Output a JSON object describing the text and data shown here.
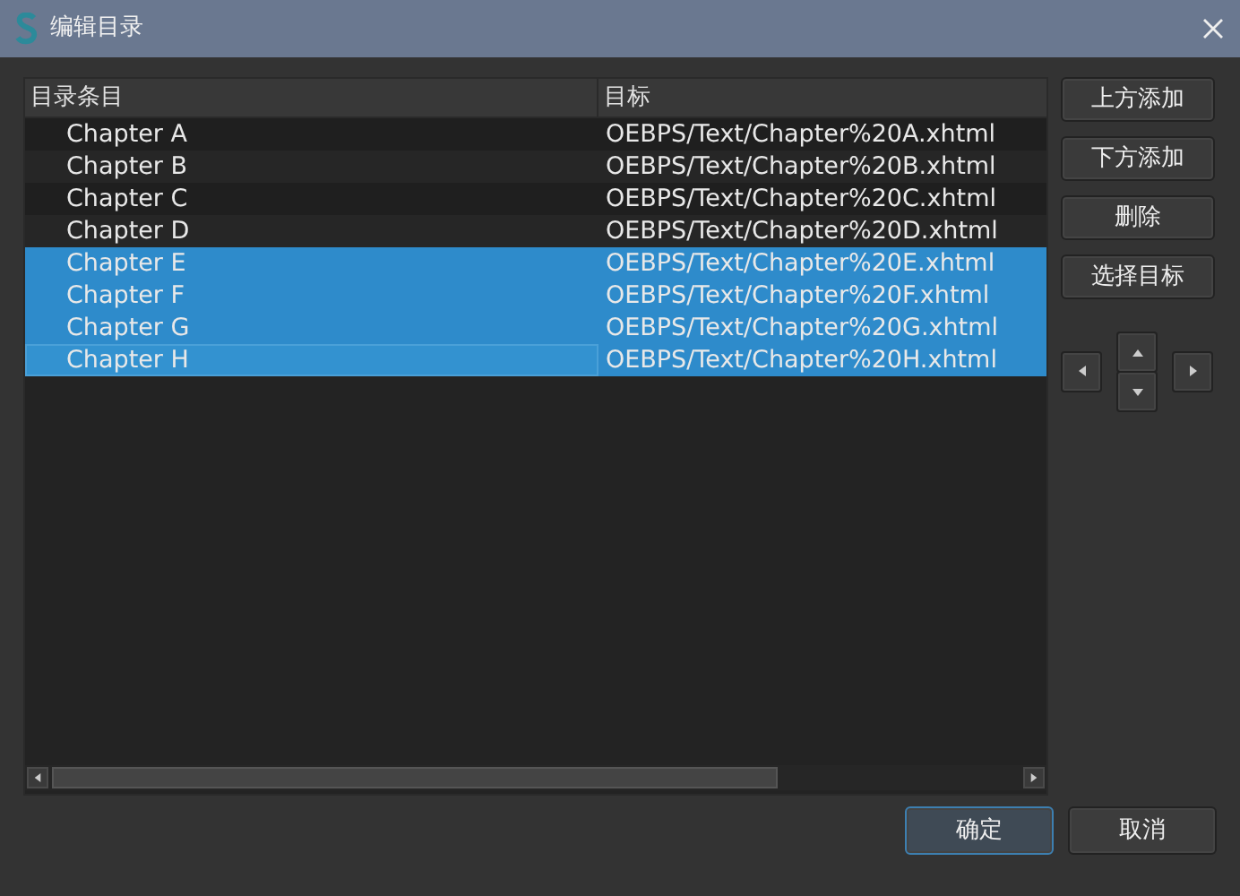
{
  "window": {
    "title": "编辑目录"
  },
  "table": {
    "columns": [
      "目录条目",
      "目标"
    ],
    "rows": [
      {
        "entry": "Chapter A",
        "target": "OEBPS/Text/Chapter%20A.xhtml",
        "selected": false
      },
      {
        "entry": "Chapter B",
        "target": "OEBPS/Text/Chapter%20B.xhtml",
        "selected": false
      },
      {
        "entry": "Chapter C",
        "target": "OEBPS/Text/Chapter%20C.xhtml",
        "selected": false
      },
      {
        "entry": "Chapter D",
        "target": "OEBPS/Text/Chapter%20D.xhtml",
        "selected": false
      },
      {
        "entry": "Chapter E",
        "target": "OEBPS/Text/Chapter%20E.xhtml",
        "selected": true
      },
      {
        "entry": "Chapter F",
        "target": "OEBPS/Text/Chapter%20F.xhtml",
        "selected": true
      },
      {
        "entry": "Chapter G",
        "target": "OEBPS/Text/Chapter%20G.xhtml",
        "selected": true
      },
      {
        "entry": "Chapter H",
        "target": "OEBPS/Text/Chapter%20H.xhtml",
        "selected": true,
        "focused": true
      }
    ]
  },
  "side_buttons": [
    "上方添加",
    "下方添加",
    "删除",
    "选择目标"
  ],
  "footer_buttons": [
    {
      "label": "确定",
      "default": true
    },
    {
      "label": "取消",
      "default": false
    }
  ]
}
